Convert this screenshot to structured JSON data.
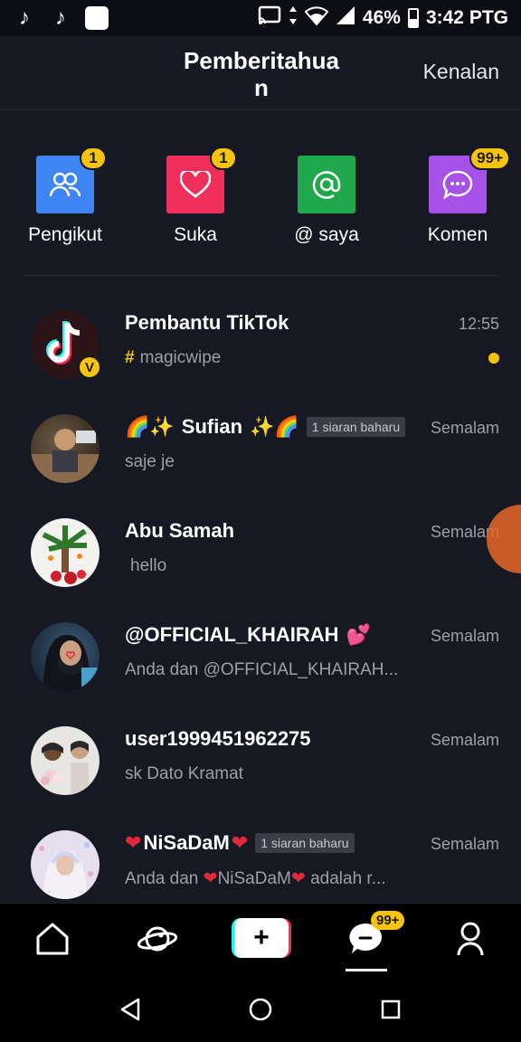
{
  "status_bar": {
    "battery": "46%",
    "time": "3:42 PTG"
  },
  "header": {
    "title": "Pemberitahuan",
    "action": "Kenalan"
  },
  "categories": [
    {
      "label": "Pengikut",
      "badge": "1",
      "color": "#3d85f5",
      "icon": "people-icon"
    },
    {
      "label": "Suka",
      "badge": "1",
      "color": "#f0305a",
      "icon": "heart-icon"
    },
    {
      "label": "@ saya",
      "badge": "",
      "color": "#1fa84c",
      "icon": "at-icon"
    },
    {
      "label": "Komen",
      "badge": "99+",
      "color": "#a651e8",
      "icon": "comment-icon"
    }
  ],
  "notifications": [
    {
      "name": "Pembantu TikTok",
      "tag": "",
      "sub": "magicwipe",
      "time": "12:55"
    },
    {
      "name": "Sufian",
      "tag": "1 siaran baharu",
      "sub": "saje je",
      "time": "Semalam"
    },
    {
      "name": "Abu Samah",
      "tag": "",
      "sub": "hello",
      "time": "Semalam"
    },
    {
      "name": "@OFFICIAL_KHAIRAH",
      "tag": "",
      "sub": "Anda dan @OFFICIAL_KHAIRAH...",
      "time": "Semalam"
    },
    {
      "name": "user1999451962275",
      "tag": "",
      "sub": "sk Dato Kramat",
      "time": "Semalam"
    },
    {
      "name": "NiSaDaM",
      "tag": "1 siaran baharu",
      "sub_a": "Anda dan",
      "sub_b": "NiSaDaM",
      "sub_c": "adalah r...",
      "time": "Semalam"
    }
  ],
  "bottom_nav": {
    "inbox_badge": "99+"
  },
  "colors": {
    "background": "#161823",
    "badge": "#f7c40b",
    "accent_cyan": "#25f4ee",
    "accent_red": "#fe2c55"
  }
}
